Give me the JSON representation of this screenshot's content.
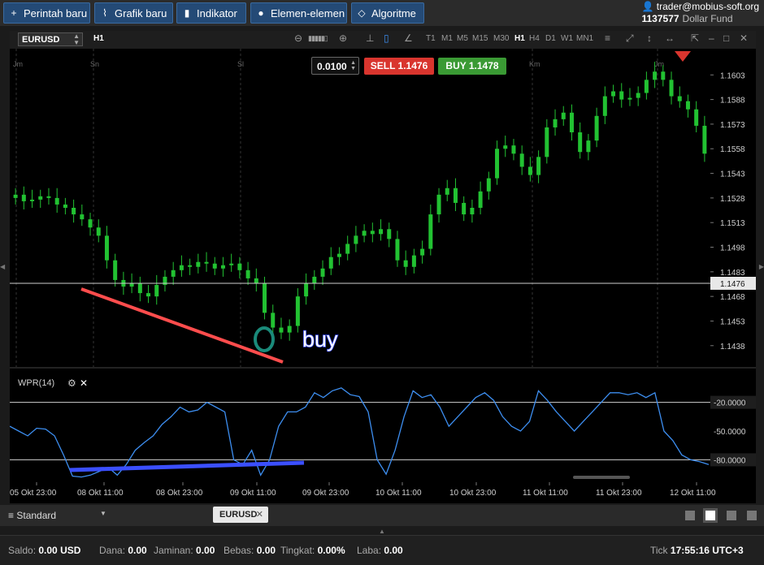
{
  "menu": {
    "items": [
      {
        "label": "Perintah baru",
        "icon": "plus-icon"
      },
      {
        "label": "Grafik baru",
        "icon": "chart-line-icon"
      },
      {
        "label": "Indikator",
        "icon": "bar-chart-icon"
      },
      {
        "label": "Elemen-elemen",
        "icon": "shapes-icon"
      },
      {
        "label": "Algoritme",
        "icon": "diamond-icon"
      }
    ]
  },
  "account": {
    "user": "trader@mobius-soft.org",
    "number": "1137577",
    "fund": "Dollar Fund"
  },
  "chart_toolbar": {
    "symbol": "EURUSD",
    "timeframe_current": "H1",
    "timeframes": [
      "T1",
      "M1",
      "M5",
      "M15",
      "M30",
      "H1",
      "H4",
      "D1",
      "W1",
      "MN1"
    ],
    "active_timeframe": "H1"
  },
  "order_panel": {
    "lot": "0.0100",
    "sell_label": "SELL",
    "sell_price": "1.1476",
    "buy_label": "BUY",
    "buy_price": "1.1478"
  },
  "chart_data": {
    "type": "candlestick",
    "symbol": "EURUSD",
    "timeframe": "H1",
    "day_labels": [
      "Jm",
      "Sn",
      "Sl",
      "Km",
      "Jm"
    ],
    "price_ticks": [
      "1.1603",
      "1.1588",
      "1.1573",
      "1.1558",
      "1.1543",
      "1.1528",
      "1.1513",
      "1.1498",
      "1.1483",
      "1.1468",
      "1.1453",
      "1.1438"
    ],
    "current_price": "1.1476",
    "ylim": [
      1.1428,
      1.1616
    ],
    "close_series": [
      1.153,
      1.1526,
      1.1527,
      1.1529,
      1.1528,
      1.1524,
      1.1522,
      1.1518,
      1.1515,
      1.151,
      1.1505,
      1.149,
      1.1478,
      1.1474,
      1.1476,
      1.147,
      1.1468,
      1.1475,
      1.148,
      1.1484,
      1.1487,
      1.1486,
      1.1489,
      1.1488,
      1.1485,
      1.1487,
      1.1488,
      1.1484,
      1.1479,
      1.1476,
      1.1458,
      1.1449,
      1.1446,
      1.145,
      1.1468,
      1.1476,
      1.148,
      1.1485,
      1.1492,
      1.1494,
      1.15,
      1.1505,
      1.1508,
      1.1506,
      1.1509,
      1.1503,
      1.149,
      1.1486,
      1.1493,
      1.1497,
      1.1518,
      1.153,
      1.1534,
      1.1525,
      1.1518,
      1.1522,
      1.1532,
      1.154,
      1.1558,
      1.156,
      1.1555,
      1.1547,
      1.1542,
      1.1553,
      1.1571,
      1.1576,
      1.158,
      1.1568,
      1.1556,
      1.1563,
      1.1578,
      1.159,
      1.1593,
      1.1588,
      1.1589,
      1.1592,
      1.16,
      1.1605,
      1.16,
      1.159,
      1.1587,
      1.1582,
      1.1572,
      1.1555
    ],
    "wpr": {
      "title": "WPR(14)",
      "levels": [
        "-20.0000",
        "-50.0000",
        "-80.0000"
      ],
      "ylim": [
        -100,
        0
      ],
      "values": [
        -45,
        -50,
        -55,
        -47,
        -48,
        -55,
        -75,
        -97,
        -98,
        -96,
        -92,
        -88,
        -96,
        -85,
        -70,
        -62,
        -55,
        -43,
        -35,
        -25,
        -30,
        -28,
        -20,
        -25,
        -30,
        -80,
        -85,
        -70,
        -96,
        -80,
        -45,
        -30,
        -30,
        -25,
        -10,
        -15,
        -8,
        -5,
        -12,
        -14,
        -30,
        -80,
        -95,
        -70,
        -35,
        -8,
        -15,
        -12,
        -25,
        -45,
        -35,
        -25,
        -15,
        -10,
        -18,
        -35,
        -45,
        -50,
        -40,
        -8,
        -18,
        -30,
        -40,
        -50,
        -40,
        -30,
        -20,
        -10,
        -10,
        -12,
        -10,
        -15,
        -10,
        -50,
        -60,
        -75,
        -80,
        -82,
        -85
      ]
    },
    "x_labels": [
      "05 Okt 23:00",
      "08 Okt 11:00",
      "08 Okt 23:00",
      "09 Okt 11:00",
      "09 Okt 23:00",
      "10 Okt 11:00",
      "10 Okt 23:00",
      "11 Okt 11:00",
      "11 Okt 23:00",
      "12 Okt 11:00"
    ],
    "annotation": "buy",
    "colors": {
      "up": "#22c232",
      "down": "#22c232",
      "wpr": "#3d8ef0",
      "trend_price": "#ff4d4d",
      "trend_wpr": "#3b4fff",
      "circle": "#1a8a7a"
    }
  },
  "tabs": {
    "profile": "Standard",
    "chart_tab": "EURUSD"
  },
  "status": {
    "saldo_label": "Saldo:",
    "saldo_value": "0.00",
    "saldo_cur": "USD",
    "dana_label": "Dana:",
    "dana_value": "0.00",
    "jaminan_label": "Jaminan:",
    "jaminan_value": "0.00",
    "bebas_label": "Bebas:",
    "bebas_value": "0.00",
    "tingkat_label": "Tingkat:",
    "tingkat_value": "0.00%",
    "laba_label": "Laba:",
    "laba_value": "0.00",
    "tick_label": "Tick",
    "time": "17:55:16",
    "tz": "UTC+3"
  }
}
